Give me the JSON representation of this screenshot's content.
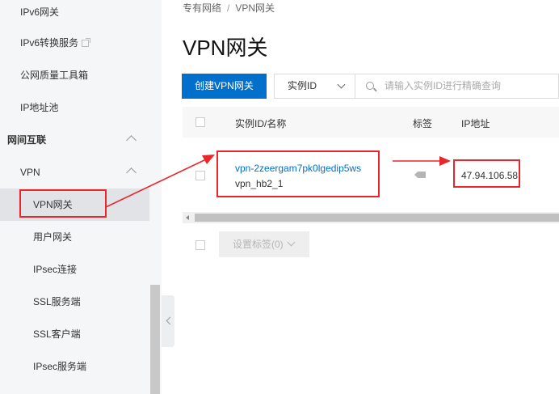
{
  "sidebar": {
    "items": [
      {
        "label": "IPv6网关"
      },
      {
        "label": "IPv6转换服务"
      },
      {
        "label": "公网质量工具箱"
      },
      {
        "label": "IP地址池"
      }
    ],
    "group_label": "网间互联",
    "vpn_label": "VPN",
    "vpn_children": [
      {
        "label": "VPN网关"
      },
      {
        "label": "用户网关"
      },
      {
        "label": "IPsec连接"
      },
      {
        "label": "SSL服务端"
      },
      {
        "label": "SSL客户端"
      },
      {
        "label": "IPsec服务端"
      }
    ]
  },
  "breadcrumb": {
    "parent": "专有网络",
    "separator": "/",
    "current": "VPN网关"
  },
  "page_title": "VPN网关",
  "toolbar": {
    "create_label": "创建VPN网关",
    "filter_select": "实例ID",
    "search_placeholder": "请输入实例ID进行精确查询"
  },
  "table": {
    "headers": {
      "id_name": "实例ID/名称",
      "tag": "标签",
      "ip": "IP地址"
    },
    "rows": [
      {
        "id": "vpn-2zeergam7pk0lgedip5ws",
        "name": "vpn_hb2_1",
        "ip": "47.94.106.58"
      }
    ]
  },
  "bulk": {
    "set_tags_label": "设置标签(0)"
  },
  "colors": {
    "accent": "#0070cc",
    "annotation": "#e8262b"
  }
}
